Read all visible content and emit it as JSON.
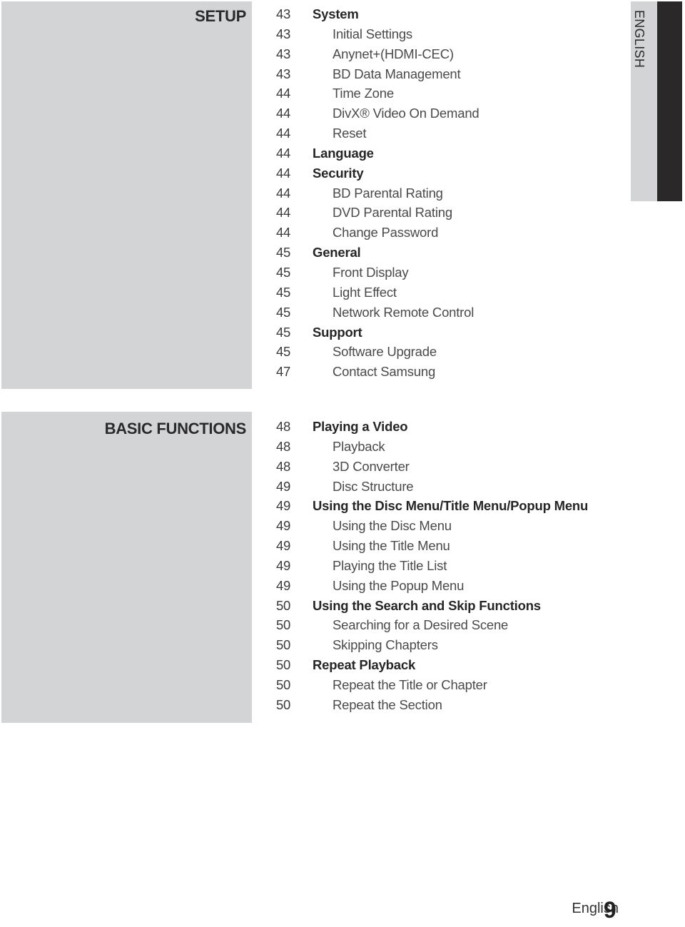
{
  "language_tab": {
    "label": "ENGLISH"
  },
  "sections": [
    {
      "title": "SETUP",
      "entries": [
        {
          "page": "43",
          "label": "System",
          "level": 1
        },
        {
          "page": "43",
          "label": "Initial Settings",
          "level": 2
        },
        {
          "page": "43",
          "label": "Anynet+(HDMI-CEC)",
          "level": 2
        },
        {
          "page": "43",
          "label": "BD Data Management",
          "level": 2
        },
        {
          "page": "44",
          "label": "Time Zone",
          "level": 2
        },
        {
          "page": "44",
          "label": "DivX® Video On Demand",
          "level": 2
        },
        {
          "page": "44",
          "label": "Reset",
          "level": 2
        },
        {
          "page": "44",
          "label": "Language",
          "level": 1
        },
        {
          "page": "44",
          "label": "Security",
          "level": 1
        },
        {
          "page": "44",
          "label": "BD Parental Rating",
          "level": 2
        },
        {
          "page": "44",
          "label": "DVD Parental Rating",
          "level": 2
        },
        {
          "page": "44",
          "label": "Change Password",
          "level": 2
        },
        {
          "page": "45",
          "label": "General",
          "level": 1
        },
        {
          "page": "45",
          "label": "Front Display",
          "level": 2
        },
        {
          "page": "45",
          "label": "Light Effect",
          "level": 2
        },
        {
          "page": "45",
          "label": "Network Remote Control",
          "level": 2
        },
        {
          "page": "45",
          "label": "Support",
          "level": 1
        },
        {
          "page": "45",
          "label": "Software Upgrade",
          "level": 2
        },
        {
          "page": "47",
          "label": "Contact Samsung",
          "level": 2
        }
      ]
    },
    {
      "title": "BASIC FUNCTIONS",
      "entries": [
        {
          "page": "48",
          "label": "Playing a Video",
          "level": 1
        },
        {
          "page": "48",
          "label": "Playback",
          "level": 2
        },
        {
          "page": "48",
          "label": "3D Converter",
          "level": 2
        },
        {
          "page": "49",
          "label": "Disc Structure",
          "level": 2
        },
        {
          "page": "49",
          "label": "Using the Disc Menu/Title Menu/Popup Menu",
          "level": 1
        },
        {
          "page": "49",
          "label": "Using the Disc Menu",
          "level": 2
        },
        {
          "page": "49",
          "label": "Using the Title Menu",
          "level": 2
        },
        {
          "page": "49",
          "label": "Playing the Title List",
          "level": 2
        },
        {
          "page": "49",
          "label": "Using the Popup Menu",
          "level": 2
        },
        {
          "page": "50",
          "label": "Using the Search and Skip Functions",
          "level": 1
        },
        {
          "page": "50",
          "label": "Searching for a Desired Scene",
          "level": 2
        },
        {
          "page": "50",
          "label": "Skipping Chapters",
          "level": 2
        },
        {
          "page": "50",
          "label": "Repeat Playback",
          "level": 1
        },
        {
          "page": "50",
          "label": "Repeat the Title or Chapter",
          "level": 2
        },
        {
          "page": "50",
          "label": "Repeat the Section",
          "level": 2
        }
      ]
    }
  ],
  "footer": {
    "language": "English",
    "page_number": "9"
  }
}
